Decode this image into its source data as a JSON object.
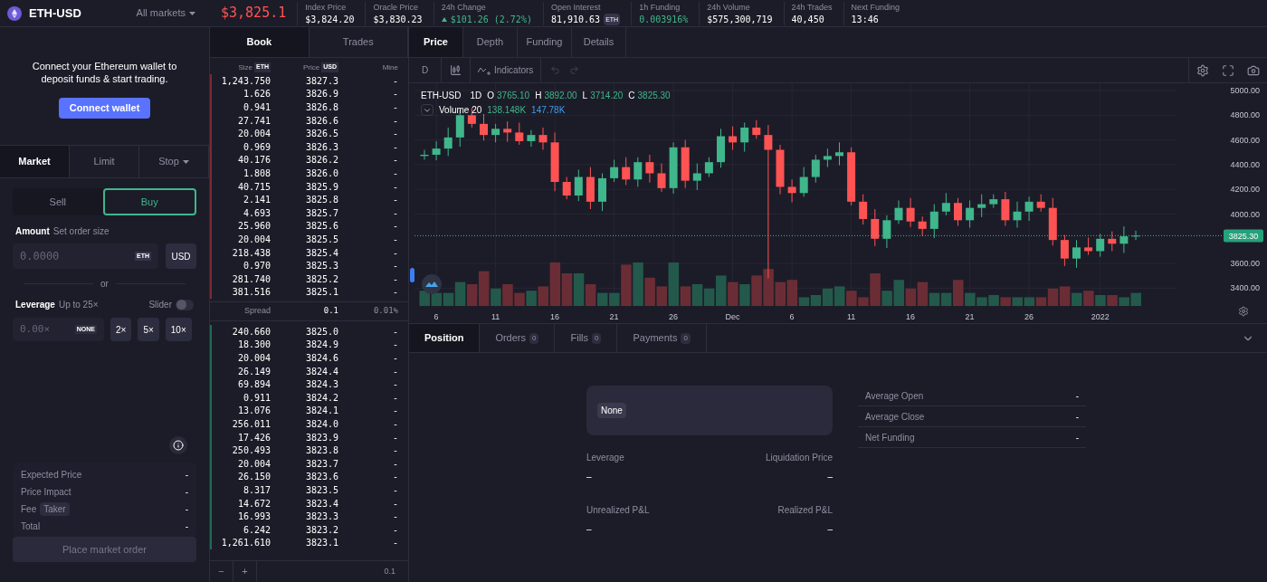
{
  "header": {
    "market": "ETH-USD",
    "markets_menu": "All markets",
    "price": "$3,825.1",
    "stats": [
      {
        "label": "Index Price",
        "value": "$3,824.20",
        "kind": "plain"
      },
      {
        "label": "Oracle Price",
        "value": "$3,830.23",
        "kind": "plain"
      },
      {
        "label": "24h Change",
        "value": "$101.26 (2.72%)",
        "kind": "change"
      },
      {
        "label": "Open Interest",
        "value": "81,910.63",
        "unit": "ETH",
        "kind": "plain"
      },
      {
        "label": "1h Funding",
        "value": "0.003916%",
        "kind": "positive"
      },
      {
        "label": "24h Volume",
        "value": "$575,300,719",
        "kind": "plain"
      },
      {
        "label": "24h Trades",
        "value": "40,450",
        "kind": "plain"
      },
      {
        "label": "Next Funding",
        "value": "13:46",
        "kind": "plain"
      }
    ]
  },
  "wallet": {
    "message": "Connect your Ethereum wallet to deposit funds & start trading.",
    "button": "Connect wallet"
  },
  "order_tabs": [
    {
      "label": "Market",
      "selected": true,
      "dropdown": false
    },
    {
      "label": "Limit",
      "selected": false,
      "dropdown": false
    },
    {
      "label": "Stop",
      "selected": false,
      "dropdown": true
    }
  ],
  "sides": [
    {
      "label": "Sell",
      "selected": false
    },
    {
      "label": "Buy",
      "selected": true
    }
  ],
  "amount": {
    "label": "Amount",
    "hint": "Set order size",
    "placeholder": "0.0000",
    "unit": "ETH",
    "toggle": "USD"
  },
  "separator": "or",
  "leverage": {
    "label": "Leverage",
    "hint": "Up to 25×",
    "slider_label": "Slider",
    "slider_on": false,
    "placeholder": "0.00×",
    "unit": "NONE",
    "presets": [
      "2×",
      "5×",
      "10×"
    ]
  },
  "summary": [
    {
      "label": "Expected Price",
      "value": "-"
    },
    {
      "label": "Price Impact",
      "value": "-"
    },
    {
      "label": "Fee",
      "tag": "Taker",
      "value": "-"
    },
    {
      "label": "Total",
      "value": "-"
    }
  ],
  "place_order": {
    "label": "Place market order",
    "disabled": true
  },
  "book": {
    "tabs": [
      {
        "label": "Book",
        "selected": true
      },
      {
        "label": "Trades",
        "selected": false
      }
    ],
    "columns": [
      {
        "label": "Size",
        "unit": "ETH"
      },
      {
        "label": "Price",
        "unit": "USD"
      },
      {
        "label": "Mine"
      }
    ],
    "asks": [
      {
        "size": "1,243.750",
        "price": "3827.3",
        "mine": "-"
      },
      {
        "size": "1.626",
        "price": "3826.9",
        "mine": "-"
      },
      {
        "size": "0.941",
        "price": "3826.8",
        "mine": "-"
      },
      {
        "size": "27.741",
        "price": "3826.6",
        "mine": "-"
      },
      {
        "size": "20.004",
        "price": "3826.5",
        "mine": "-"
      },
      {
        "size": "0.969",
        "price": "3826.3",
        "mine": "-"
      },
      {
        "size": "40.176",
        "price": "3826.2",
        "mine": "-"
      },
      {
        "size": "1.808",
        "price": "3826.0",
        "mine": "-"
      },
      {
        "size": "40.715",
        "price": "3825.9",
        "mine": "-"
      },
      {
        "size": "2.141",
        "price": "3825.8",
        "mine": "-"
      },
      {
        "size": "4.693",
        "price": "3825.7",
        "mine": "-"
      },
      {
        "size": "25.960",
        "price": "3825.6",
        "mine": "-"
      },
      {
        "size": "20.004",
        "price": "3825.5",
        "mine": "-"
      },
      {
        "size": "218.438",
        "price": "3825.4",
        "mine": "-"
      },
      {
        "size": "0.970",
        "price": "3825.3",
        "mine": "-"
      },
      {
        "size": "281.740",
        "price": "3825.2",
        "mine": "-"
      },
      {
        "size": "381.516",
        "price": "3825.1",
        "mine": "-"
      }
    ],
    "spread": {
      "label": "Spread",
      "value": "0.1",
      "percent": "0.01%"
    },
    "bids": [
      {
        "size": "240.660",
        "price": "3825.0",
        "mine": "-"
      },
      {
        "size": "18.300",
        "price": "3824.9",
        "mine": "-"
      },
      {
        "size": "20.004",
        "price": "3824.6",
        "mine": "-"
      },
      {
        "size": "26.149",
        "price": "3824.4",
        "mine": "-"
      },
      {
        "size": "69.894",
        "price": "3824.3",
        "mine": "-"
      },
      {
        "size": "0.911",
        "price": "3824.2",
        "mine": "-"
      },
      {
        "size": "13.076",
        "price": "3824.1",
        "mine": "-"
      },
      {
        "size": "256.011",
        "price": "3824.0",
        "mine": "-"
      },
      {
        "size": "17.426",
        "price": "3823.9",
        "mine": "-"
      },
      {
        "size": "250.493",
        "price": "3823.8",
        "mine": "-"
      },
      {
        "size": "20.004",
        "price": "3823.7",
        "mine": "-"
      },
      {
        "size": "26.150",
        "price": "3823.6",
        "mine": "-"
      },
      {
        "size": "8.317",
        "price": "3823.5",
        "mine": "-"
      },
      {
        "size": "14.672",
        "price": "3823.4",
        "mine": "-"
      },
      {
        "size": "16.993",
        "price": "3823.3",
        "mine": "-"
      },
      {
        "size": "6.242",
        "price": "3823.2",
        "mine": "-"
      },
      {
        "size": "1,261.610",
        "price": "3823.1",
        "mine": "-"
      }
    ],
    "footer": {
      "minus": "−",
      "plus": "+",
      "step": "0.1"
    }
  },
  "chart_tabs": [
    {
      "label": "Price",
      "selected": true
    },
    {
      "label": "Depth",
      "selected": false
    },
    {
      "label": "Funding",
      "selected": false
    },
    {
      "label": "Details",
      "selected": false
    }
  ],
  "toolbar": {
    "interval": "D",
    "indicators": "Indicators"
  },
  "chart": {
    "symbol": "ETH-USD",
    "interval": "1D",
    "ohlc": [
      {
        "label": "O",
        "value": "3765.10"
      },
      {
        "label": "H",
        "value": "3892.00"
      },
      {
        "label": "L",
        "value": "3714.20"
      },
      {
        "label": "C",
        "value": "3825.30"
      }
    ],
    "volume": {
      "label": "Volume 20",
      "value": "138.148K",
      "average": "147.78K"
    },
    "last_price": "3825.30",
    "y_labels": [
      "5000.00",
      "4800.00",
      "4600.00",
      "4400.00",
      "4200.00",
      "4000.00",
      "3600.00",
      "3400.00"
    ],
    "x_labels": [
      "6",
      "11",
      "16",
      "21",
      "26",
      "Dec",
      "6",
      "11",
      "16",
      "21",
      "26",
      "2022"
    ]
  },
  "position_tabs": [
    {
      "label": "Position",
      "selected": true
    },
    {
      "label": "Orders",
      "count": "0",
      "selected": false
    },
    {
      "label": "Fills",
      "count": "0",
      "selected": false
    },
    {
      "label": "Payments",
      "count": "0",
      "selected": false
    }
  ],
  "position": {
    "status": "None",
    "stats": [
      {
        "label": "Leverage",
        "value": "–"
      },
      {
        "label": "Liquidation Price",
        "value": "–"
      },
      {
        "label": "Unrealized P&L",
        "value": "–"
      },
      {
        "label": "Realized P&L",
        "value": "–"
      }
    ],
    "details": [
      {
        "label": "Average Open",
        "value": "-"
      },
      {
        "label": "Average Close",
        "value": "-"
      },
      {
        "label": "Net Funding",
        "value": "-"
      }
    ]
  }
}
